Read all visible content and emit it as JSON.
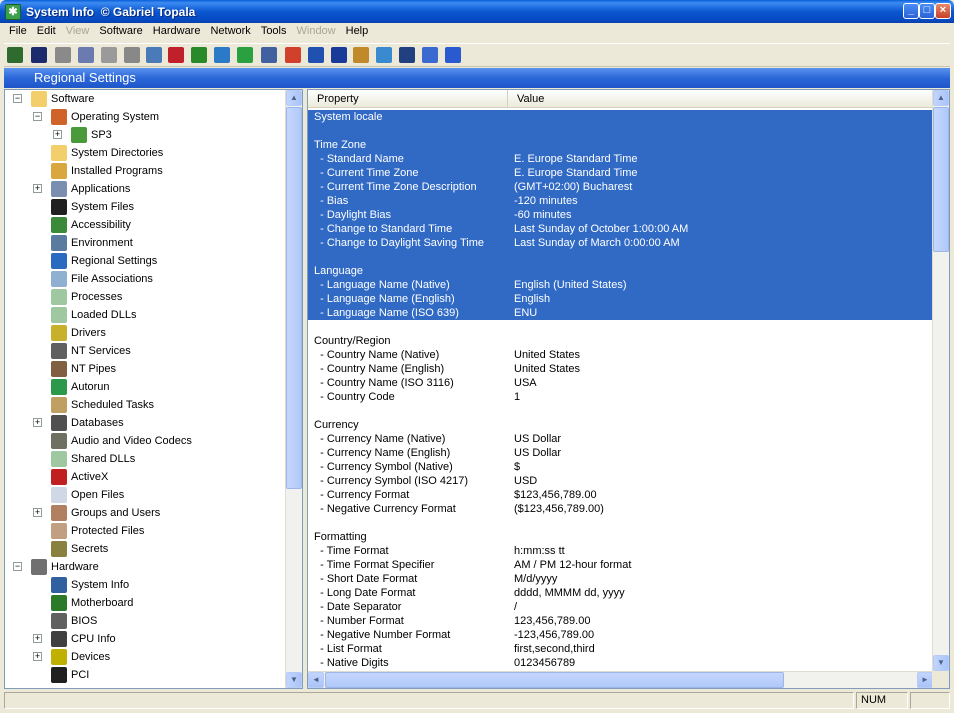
{
  "window": {
    "title": "System Info",
    "author": "Gabriel Topala",
    "author_mark": "©"
  },
  "menu": [
    {
      "label": "File",
      "enabled": true
    },
    {
      "label": "Edit",
      "enabled": true
    },
    {
      "label": "View",
      "enabled": false
    },
    {
      "label": "Software",
      "enabled": true
    },
    {
      "label": "Hardware",
      "enabled": true
    },
    {
      "label": "Network",
      "enabled": true
    },
    {
      "label": "Tools",
      "enabled": true
    },
    {
      "label": "Window",
      "enabled": false
    },
    {
      "label": "Help",
      "enabled": true
    }
  ],
  "toolbar_icons": [
    {
      "name": "exit-icon",
      "color": "#2f6b2f"
    },
    {
      "name": "save-icon",
      "color": "#1b2b6b"
    },
    {
      "name": "cut-icon",
      "color": "#8a8a8a"
    },
    {
      "name": "copy-icon",
      "color": "#6b7bb0"
    },
    {
      "name": "paste-icon",
      "color": "#9a9a9a"
    },
    {
      "name": "stop-icon",
      "color": "#888888"
    },
    {
      "name": "report-icon",
      "color": "#4a7ab8"
    },
    {
      "name": "color-icon",
      "color": "#c0202a"
    },
    {
      "name": "graph-icon",
      "color": "#2a8a2a"
    },
    {
      "name": "globe-icon",
      "color": "#2a7ac8"
    },
    {
      "name": "refresh-icon",
      "color": "#2aa040"
    },
    {
      "name": "document-icon",
      "color": "#4060a0"
    },
    {
      "name": "remove-icon",
      "color": "#d0402a"
    },
    {
      "name": "network-icon",
      "color": "#2050b0"
    },
    {
      "name": "shield-icon",
      "color": "#1a3a9a"
    },
    {
      "name": "tasks-icon",
      "color": "#c08a2a"
    },
    {
      "name": "internet-icon",
      "color": "#3a8ad0"
    },
    {
      "name": "camera-icon",
      "color": "#204080"
    },
    {
      "name": "key-icon",
      "color": "#3a6ad0"
    },
    {
      "name": "help-icon",
      "color": "#2a5ad0"
    }
  ],
  "section_title": "Regional Settings",
  "tree": [
    {
      "label": "Software",
      "level": 0,
      "expander": "−",
      "icon": "folder-icon",
      "color": "#f2cf6a"
    },
    {
      "label": "Operating System",
      "level": 1,
      "expander": "−",
      "icon": "windows-icon",
      "color": "#d0632a"
    },
    {
      "label": "SP3",
      "level": 2,
      "expander": "+",
      "icon": "windows-icon",
      "color": "#4a9a3a"
    },
    {
      "label": "System Directories",
      "level": 1,
      "expander": "",
      "icon": "folder-icon",
      "color": "#f2cf6a"
    },
    {
      "label": "Installed Programs",
      "level": 1,
      "expander": "",
      "icon": "programs-icon",
      "color": "#d9a640"
    },
    {
      "label": "Applications",
      "level": 1,
      "expander": "+",
      "icon": "applications-icon",
      "color": "#7a8fb0"
    },
    {
      "label": "System Files",
      "level": 1,
      "expander": "",
      "icon": "console-icon",
      "color": "#202020"
    },
    {
      "label": "Accessibility",
      "level": 1,
      "expander": "",
      "icon": "accessibility-icon",
      "color": "#3a8a3a"
    },
    {
      "label": "Environment",
      "level": 1,
      "expander": "",
      "icon": "environment-icon",
      "color": "#5a7aa0"
    },
    {
      "label": "Regional Settings",
      "level": 1,
      "expander": "",
      "icon": "globe-icon",
      "color": "#2a6ac0"
    },
    {
      "label": "File Associations",
      "level": 1,
      "expander": "",
      "icon": "file-associations-icon",
      "color": "#8fb0d0"
    },
    {
      "label": "Processes",
      "level": 1,
      "expander": "",
      "icon": "processes-icon",
      "color": "#a0c8a0"
    },
    {
      "label": "Loaded DLLs",
      "level": 1,
      "expander": "",
      "icon": "dll-icon",
      "color": "#a0c8a0"
    },
    {
      "label": "Drivers",
      "level": 1,
      "expander": "",
      "icon": "drivers-icon",
      "color": "#c8b02a"
    },
    {
      "label": "NT Services",
      "level": 1,
      "expander": "",
      "icon": "services-icon",
      "color": "#606060"
    },
    {
      "label": "NT Pipes",
      "level": 1,
      "expander": "",
      "icon": "pipes-icon",
      "color": "#806040"
    },
    {
      "label": "Autorun",
      "level": 1,
      "expander": "",
      "icon": "autorun-icon",
      "color": "#2a9a4a"
    },
    {
      "label": "Scheduled Tasks",
      "level": 1,
      "expander": "",
      "icon": "tasks-icon",
      "color": "#c0a060"
    },
    {
      "label": "Databases",
      "level": 1,
      "expander": "+",
      "icon": "database-icon",
      "color": "#505050"
    },
    {
      "label": "Audio and Video Codecs",
      "level": 1,
      "expander": "",
      "icon": "codecs-icon",
      "color": "#707060"
    },
    {
      "label": "Shared DLLs",
      "level": 1,
      "expander": "",
      "icon": "dll-icon",
      "color": "#a0c8a0"
    },
    {
      "label": "ActiveX",
      "level": 1,
      "expander": "",
      "icon": "activex-icon",
      "color": "#c02020"
    },
    {
      "label": "Open Files",
      "level": 1,
      "expander": "",
      "icon": "file-icon",
      "color": "#d0d8e8"
    },
    {
      "label": "Groups and Users",
      "level": 1,
      "expander": "+",
      "icon": "users-icon",
      "color": "#b08060"
    },
    {
      "label": "Protected Files",
      "level": 1,
      "expander": "",
      "icon": "protected-files-icon",
      "color": "#c0a080"
    },
    {
      "label": "Secrets",
      "level": 1,
      "expander": "",
      "icon": "key-icon",
      "color": "#8a8040"
    },
    {
      "label": "Hardware",
      "level": 0,
      "expander": "−",
      "icon": "hardware-icon",
      "color": "#707070"
    },
    {
      "label": "System Info",
      "level": 1,
      "expander": "",
      "icon": "computer-icon",
      "color": "#3060a0"
    },
    {
      "label": "Motherboard",
      "level": 1,
      "expander": "",
      "icon": "motherboard-icon",
      "color": "#2a7a2a"
    },
    {
      "label": "BIOS",
      "level": 1,
      "expander": "",
      "icon": "bios-icon",
      "color": "#606060"
    },
    {
      "label": "CPU Info",
      "level": 1,
      "expander": "+",
      "icon": "cpu-icon",
      "color": "#404040"
    },
    {
      "label": "Devices",
      "level": 1,
      "expander": "+",
      "icon": "devices-icon",
      "color": "#c0b000"
    },
    {
      "label": "PCI",
      "level": 1,
      "expander": "",
      "icon": "pci-icon",
      "color": "#202020"
    }
  ],
  "columns": {
    "property": "Property",
    "value": "Value"
  },
  "rows": [
    {
      "p": "System locale",
      "v": "",
      "sel": true
    },
    {
      "p": "",
      "v": "",
      "sel": true
    },
    {
      "p": "Time Zone",
      "v": "",
      "sel": true
    },
    {
      "p": "  - Standard Name",
      "v": "E. Europe Standard Time",
      "sel": true
    },
    {
      "p": "  - Current Time Zone",
      "v": "E. Europe Standard Time",
      "sel": true
    },
    {
      "p": "  - Current Time Zone Description",
      "v": "(GMT+02:00) Bucharest",
      "sel": true
    },
    {
      "p": "  - Bias",
      "v": "-120 minutes",
      "sel": true
    },
    {
      "p": "  - Daylight Bias",
      "v": "-60 minutes",
      "sel": true
    },
    {
      "p": "  - Change to Standard Time",
      "v": "Last Sunday of October 1:00:00 AM",
      "sel": true
    },
    {
      "p": "  - Change to Daylight Saving Time",
      "v": "Last Sunday of March 0:00:00 AM",
      "sel": true
    },
    {
      "p": "",
      "v": "",
      "sel": true
    },
    {
      "p": "Language",
      "v": "",
      "sel": true
    },
    {
      "p": "  - Language Name (Native)",
      "v": "English (United States)",
      "sel": true
    },
    {
      "p": "  - Language Name (English)",
      "v": "English",
      "sel": true
    },
    {
      "p": "  - Language Name (ISO 639)",
      "v": "ENU",
      "sel": true
    },
    {
      "p": "",
      "v": "",
      "sel": false
    },
    {
      "p": "Country/Region",
      "v": "",
      "sel": false
    },
    {
      "p": "  - Country Name (Native)",
      "v": "United States",
      "sel": false
    },
    {
      "p": "  - Country Name (English)",
      "v": "United States",
      "sel": false
    },
    {
      "p": "  - Country Name (ISO 3116)",
      "v": "USA",
      "sel": false
    },
    {
      "p": "  - Country Code",
      "v": "1",
      "sel": false
    },
    {
      "p": "",
      "v": "",
      "sel": false
    },
    {
      "p": "Currency",
      "v": "",
      "sel": false
    },
    {
      "p": "  - Currency Name (Native)",
      "v": "US Dollar",
      "sel": false
    },
    {
      "p": "  - Currency Name (English)",
      "v": "US Dollar",
      "sel": false
    },
    {
      "p": "  - Currency Symbol (Native)",
      "v": "$",
      "sel": false
    },
    {
      "p": "  - Currency Symbol (ISO 4217)",
      "v": "USD",
      "sel": false
    },
    {
      "p": "  - Currency Format",
      "v": "$123,456,789.00",
      "sel": false
    },
    {
      "p": "  - Negative Currency Format",
      "v": "($123,456,789.00)",
      "sel": false
    },
    {
      "p": "",
      "v": "",
      "sel": false
    },
    {
      "p": "Formatting",
      "v": "",
      "sel": false
    },
    {
      "p": "  - Time Format",
      "v": "h:mm:ss tt",
      "sel": false
    },
    {
      "p": "  - Time Format Specifier",
      "v": "AM / PM 12-hour format",
      "sel": false
    },
    {
      "p": "  - Short Date Format",
      "v": "M/d/yyyy",
      "sel": false
    },
    {
      "p": "  - Long Date Format",
      "v": "dddd, MMMM dd, yyyy",
      "sel": false
    },
    {
      "p": "  - Date Separator",
      "v": "/",
      "sel": false
    },
    {
      "p": "  - Number Format",
      "v": "123,456,789.00",
      "sel": false
    },
    {
      "p": "  - Negative Number Format",
      "v": "-123,456,789.00",
      "sel": false
    },
    {
      "p": "  - List Format",
      "v": "first,second,third",
      "sel": false
    },
    {
      "p": "  - Native Digits",
      "v": "0123456789",
      "sel": false
    }
  ],
  "status": {
    "num": "NUM"
  }
}
